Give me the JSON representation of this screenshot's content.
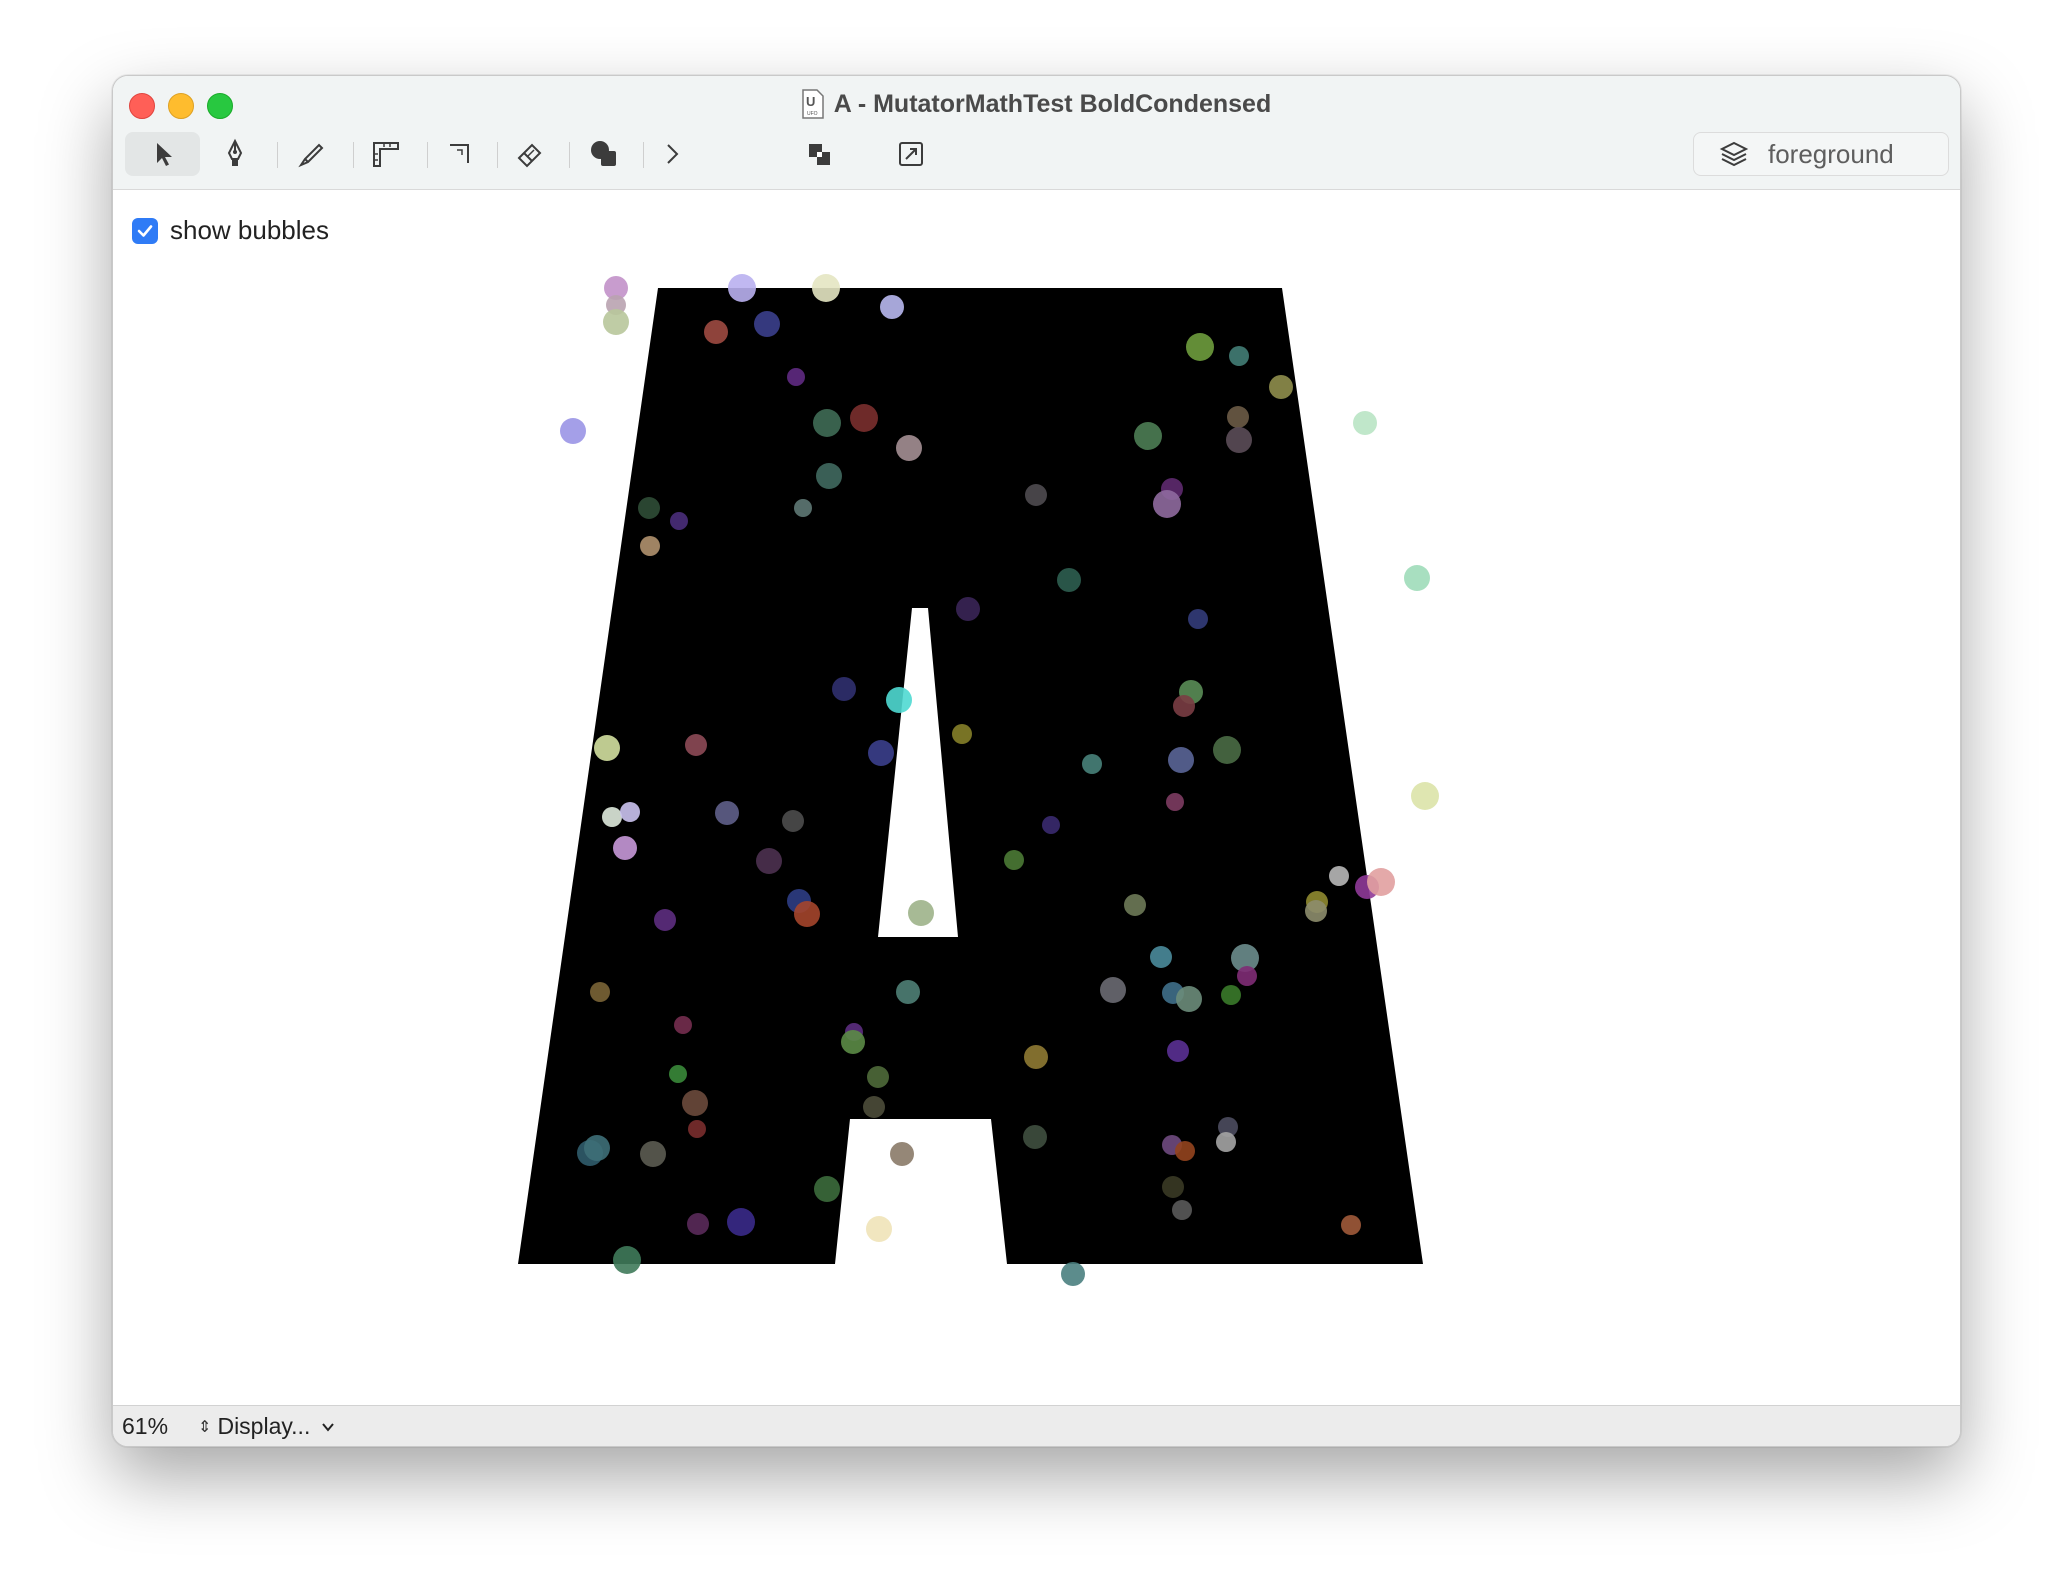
{
  "window": {
    "title": "A - MutatorMathTest BoldCondensed",
    "doc_icon_letter": "U",
    "doc_icon_sub": "UFO"
  },
  "toolbar": {
    "tools": [
      "selection-arrow-icon",
      "pen-icon",
      "knife-icon",
      "ruler-icon",
      "corner-icon",
      "eraser-icon",
      "shapes-icon",
      "chevron-right-icon",
      "overlap-squares-icon",
      "replace-icon"
    ],
    "active_tool": "selection-arrow-icon",
    "layer_label": "foreground"
  },
  "bubbles_toggle": {
    "label": "show bubbles",
    "checked": true,
    "accent": "#2f7bf6"
  },
  "glyph": {
    "name": "A",
    "fill": "#000000"
  },
  "status": {
    "zoom": "61%",
    "display_label": "Display..."
  }
}
